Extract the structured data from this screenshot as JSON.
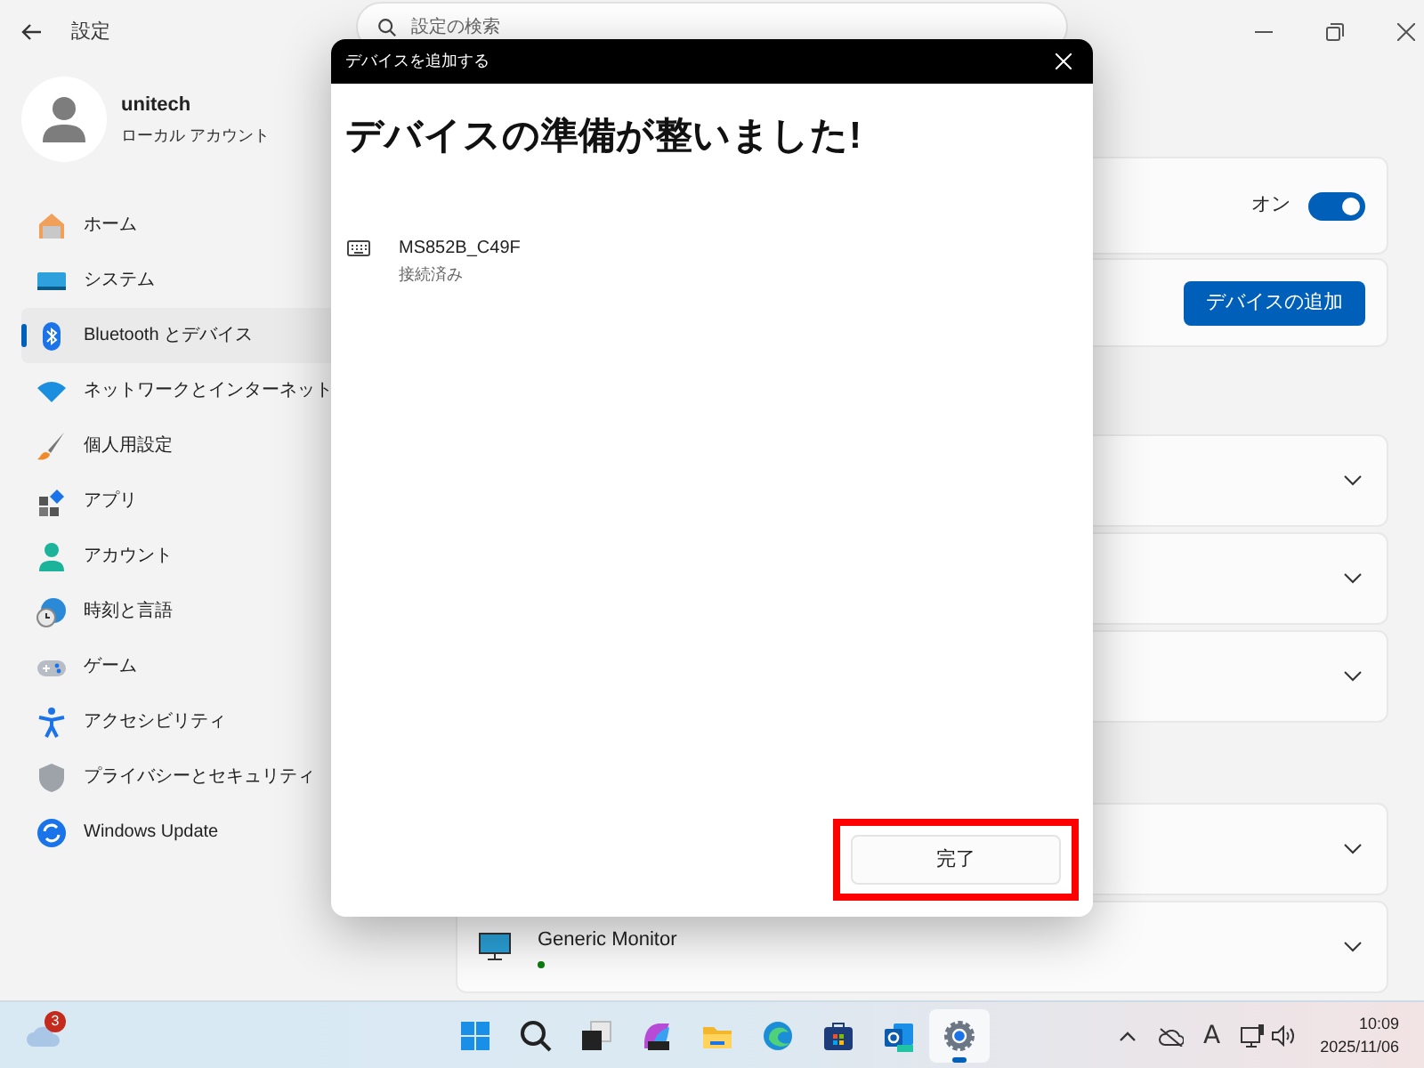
{
  "window": {
    "title": "設定"
  },
  "search": {
    "placeholder": "設定の検索"
  },
  "account": {
    "name": "unitech",
    "type": "ローカル アカウント"
  },
  "nav": [
    {
      "label": "ホーム",
      "kind": "home",
      "selected": false
    },
    {
      "label": "システム",
      "kind": "system",
      "selected": false
    },
    {
      "label": "Bluetooth とデバイス",
      "kind": "bluetooth",
      "selected": true
    },
    {
      "label": "ネットワークとインターネット",
      "kind": "network",
      "selected": false
    },
    {
      "label": "個人用設定",
      "kind": "brush",
      "selected": false
    },
    {
      "label": "アプリ",
      "kind": "apps",
      "selected": false
    },
    {
      "label": "アカウント",
      "kind": "account",
      "selected": false
    },
    {
      "label": "時刻と言語",
      "kind": "time",
      "selected": false
    },
    {
      "label": "ゲーム",
      "kind": "game",
      "selected": false
    },
    {
      "label": "アクセシビリティ",
      "kind": "accessibility",
      "selected": false
    },
    {
      "label": "プライバシーとセキュリティ",
      "kind": "shield",
      "selected": false
    },
    {
      "label": "Windows Update",
      "kind": "update",
      "selected": false
    }
  ],
  "bluetooth_card": {
    "state_label": "オン",
    "on": true
  },
  "add_device_button": "デバイスの追加",
  "monitor_card": {
    "name": "Generic Monitor",
    "connected": true
  },
  "dialog": {
    "title": "デバイスを追加する",
    "heading": "デバイスの準備が整いました!",
    "device": {
      "name": "MS852B_C49F",
      "status": "接続済み"
    },
    "done_button": "完了",
    "highlighted": true
  },
  "taskbar": {
    "weather_badge": "3",
    "apps": [
      {
        "kind": "start",
        "selected": false
      },
      {
        "kind": "search",
        "selected": false
      },
      {
        "kind": "taskview",
        "selected": false
      },
      {
        "kind": "copilot",
        "selected": false
      },
      {
        "kind": "explorer",
        "selected": false
      },
      {
        "kind": "edge",
        "selected": false
      },
      {
        "kind": "store",
        "selected": false
      },
      {
        "kind": "outlook",
        "selected": false
      },
      {
        "kind": "settings",
        "selected": true
      }
    ],
    "ime": "A",
    "time": "10:09",
    "date": "2025/11/06"
  }
}
